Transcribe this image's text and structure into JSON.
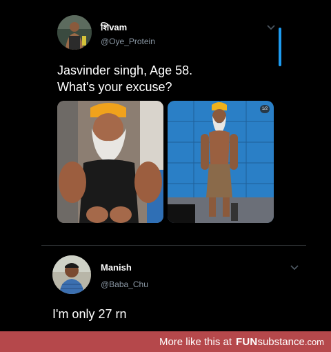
{
  "tweet1": {
    "name": "शिvam",
    "handle": "@Oye_Protein",
    "text_line1": "Jasvinder singh, Age 58.",
    "text_line2": "What's your excuse?",
    "photo_badge": "1/2"
  },
  "tweet2": {
    "name": "Manish",
    "handle": "@Baba_Chu",
    "text": "I'm only 27 rn"
  },
  "footer": {
    "prefix": "More like this at",
    "brand_fun": "FUN",
    "brand_sub": "substance",
    "brand_tld": ".com"
  },
  "colors": {
    "background": "#000000",
    "footer_bg": "#b5484b",
    "handle_gray": "#8b98a5",
    "scroll_blue": "#1d9bf0"
  },
  "icons": [
    "chevron-down-icon",
    "avatar"
  ]
}
